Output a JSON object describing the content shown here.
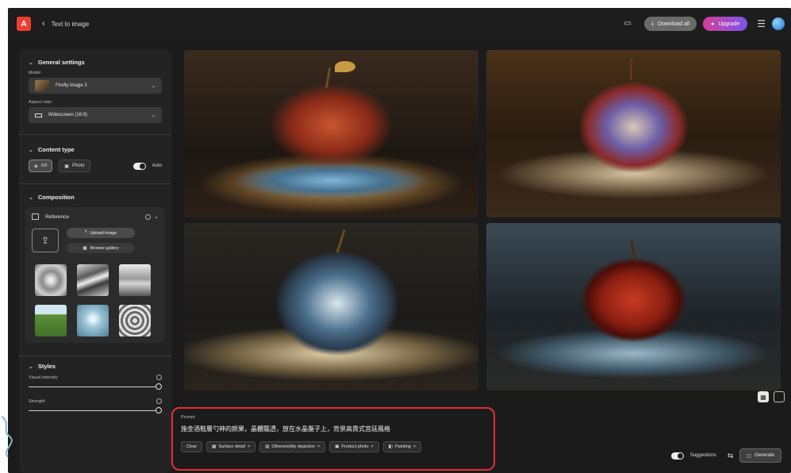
{
  "header": {
    "logo_letter": "A",
    "back_label": "Text to image",
    "download_label": "Download all",
    "upgrade_label": "Upgrade"
  },
  "sidebar": {
    "general": {
      "title": "General settings",
      "model_label": "Model",
      "model_value": "Firefly Image 3",
      "aspect_label": "Aspect ratio",
      "aspect_value": "Widescreen (16:9)"
    },
    "content_type": {
      "title": "Content type",
      "art_label": "Art",
      "photo_label": "Photo",
      "auto_label": "Auto"
    },
    "composition": {
      "title": "Composition",
      "reference_label": "Reference",
      "upload_label": "Upload image",
      "browse_label": "Browse gallery"
    },
    "styles": {
      "title": "Styles",
      "visual_intensity_label": "Visual intensity",
      "strength_label": "Strength"
    }
  },
  "prompt": {
    "label": "Prompt",
    "text": "施金酒鞋層勺神的颜果，晶體瓢透，放在水晶盤子上，背景高貴式宮廷風格",
    "chips": [
      {
        "label": "Clear",
        "icon": ""
      },
      {
        "label": "Surface detail",
        "icon": "texture-icon"
      },
      {
        "label": "Otherworldly depiction",
        "icon": "style-icon"
      },
      {
        "label": "Product photo",
        "icon": "camera-icon"
      },
      {
        "label": "Painting",
        "icon": "brush-icon"
      }
    ]
  },
  "footer": {
    "suggestions_label": "Suggestions",
    "generate_label": "Generate"
  },
  "colors": {
    "accent_red": "#e03030",
    "upgrade_gradient_start": "#d43f9b",
    "upgrade_gradient_end": "#7a54e8"
  }
}
